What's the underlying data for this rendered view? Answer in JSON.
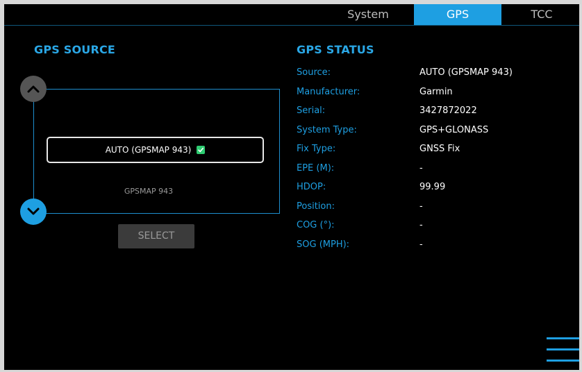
{
  "tabs": [
    {
      "label": "System",
      "active": false
    },
    {
      "label": "GPS",
      "active": true
    },
    {
      "label": "TCC",
      "active": false
    }
  ],
  "colors": {
    "accent": "#1e9fe2",
    "background": "#000000",
    "check": "#2ecc71",
    "select_button": "#3b3b3b"
  },
  "source": {
    "title": "GPS SOURCE",
    "items": [
      {
        "label": "AUTO (GPSMAP 943)",
        "selected": true
      },
      {
        "label": "GPSMAP 943",
        "selected": false
      }
    ],
    "select_label": "SELECT",
    "icons": {
      "up": "chevron-up-icon",
      "down": "chevron-down-icon",
      "check": "check-icon",
      "menu": "hamburger-menu-icon"
    }
  },
  "status": {
    "title": "GPS STATUS",
    "rows": [
      {
        "label": "Source:",
        "value": "AUTO (GPSMAP 943)"
      },
      {
        "label": "Manufacturer:",
        "value": "Garmin"
      },
      {
        "label": "Serial:",
        "value": "3427872022"
      },
      {
        "label": "System Type:",
        "value": "GPS+GLONASS"
      },
      {
        "label": "Fix Type:",
        "value": "GNSS Fix"
      },
      {
        "label": "EPE (M):",
        "value": "-"
      },
      {
        "label": "HDOP:",
        "value": "99.99"
      },
      {
        "label": "Position:",
        "value": "-"
      },
      {
        "label": "COG (°):",
        "value": "-"
      },
      {
        "label": "SOG (MPH):",
        "value": "-"
      }
    ]
  }
}
